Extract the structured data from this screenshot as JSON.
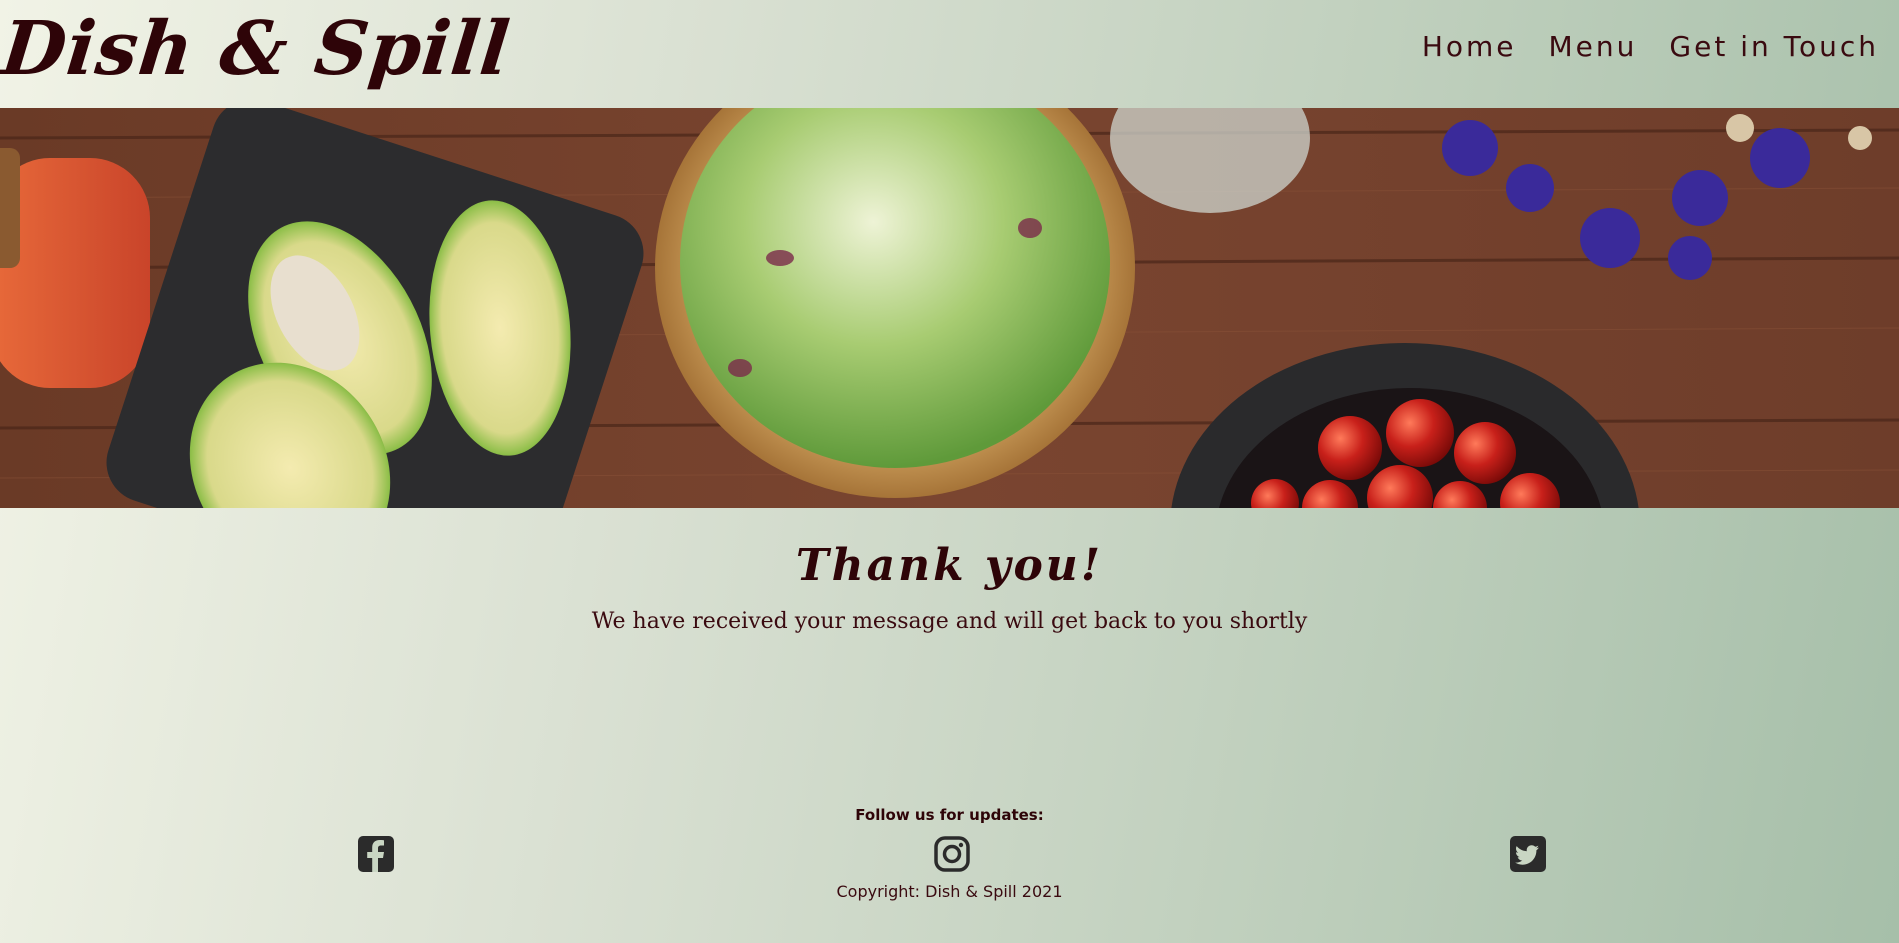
{
  "brand": {
    "name": "Dish & Spill"
  },
  "nav": {
    "items": [
      {
        "label": "Home"
      },
      {
        "label": "Menu"
      },
      {
        "label": "Get in Touch"
      }
    ]
  },
  "hero": {
    "icon": "salad-table-photo"
  },
  "main": {
    "title": "Thank you!",
    "message": "We have received your message and will get back to you shortly"
  },
  "footer": {
    "follow_text": "Follow us for updates:",
    "social": [
      {
        "icon": "facebook-icon"
      },
      {
        "icon": "instagram-icon"
      },
      {
        "icon": "twitter-icon"
      }
    ],
    "copyright": "Copyright: Dish & Spill 2021"
  },
  "colors": {
    "brand_text": "#2e0408",
    "social_icon": "#2b2b2b",
    "background_start": "#f1f3e6",
    "background_end": "#a6bfa9"
  }
}
